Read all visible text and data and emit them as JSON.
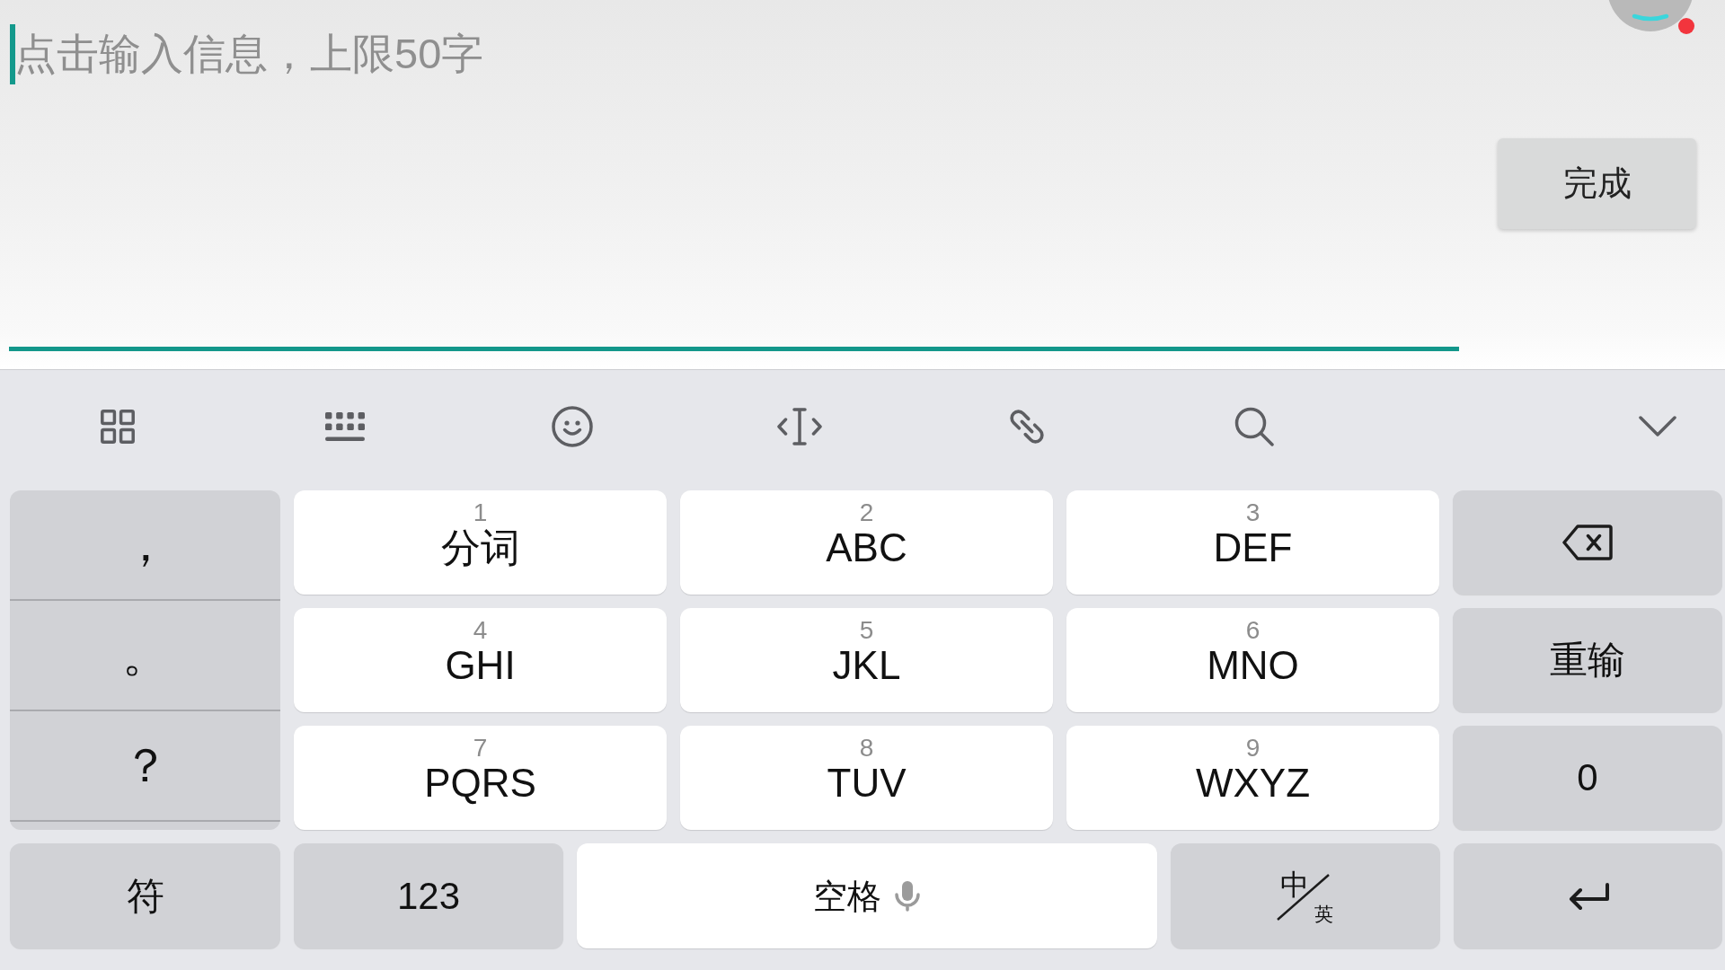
{
  "input": {
    "placeholder": "点击输入信息，上限50字",
    "focused": true
  },
  "done_button": {
    "label": "完成"
  },
  "floating_ball": {
    "notification_dot": true
  },
  "keyboard": {
    "punctuation": [
      "，",
      "。",
      "？"
    ],
    "keys": [
      {
        "digit": "1",
        "letters": "分词"
      },
      {
        "digit": "2",
        "letters": "ABC"
      },
      {
        "digit": "3",
        "letters": "DEF"
      },
      {
        "digit": "4",
        "letters": "GHI"
      },
      {
        "digit": "5",
        "letters": "JKL"
      },
      {
        "digit": "6",
        "letters": "MNO"
      },
      {
        "digit": "7",
        "letters": "PQRS"
      },
      {
        "digit": "8",
        "letters": "TUV"
      },
      {
        "digit": "9",
        "letters": "WXYZ"
      }
    ],
    "side_keys": [
      {
        "kind": "backspace"
      },
      {
        "kind": "retype",
        "label": "重输"
      },
      {
        "kind": "digit",
        "label": "0"
      }
    ],
    "bottom_row": [
      {
        "kind": "symbols",
        "label": "符"
      },
      {
        "kind": "numbers",
        "label": "123"
      },
      {
        "kind": "space",
        "label": "空格"
      },
      {
        "kind": "language",
        "primary": "中",
        "secondary": "英"
      },
      {
        "kind": "enter"
      }
    ]
  }
}
